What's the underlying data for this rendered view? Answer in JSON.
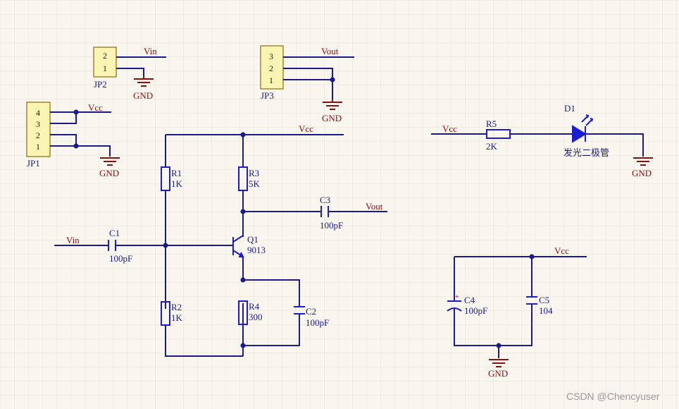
{
  "connectors": {
    "jp1": {
      "name": "JP1",
      "pins": [
        "4",
        "3",
        "2",
        "1"
      ]
    },
    "jp2": {
      "name": "JP2",
      "pins": [
        "2",
        "1"
      ]
    },
    "jp3": {
      "name": "JP3",
      "pins": [
        "3",
        "2",
        "1"
      ]
    }
  },
  "nets": {
    "vin": "Vin",
    "vout": "Vout",
    "vcc": "Vcc",
    "gnd": "GND"
  },
  "components": {
    "r1": {
      "name": "R1",
      "value": "1K"
    },
    "r2": {
      "name": "R2",
      "value": "1K"
    },
    "r3": {
      "name": "R3",
      "value": "5K"
    },
    "r4": {
      "name": "R4",
      "value": "300"
    },
    "r5": {
      "name": "R5",
      "value": "2K"
    },
    "c1": {
      "name": "C1",
      "value": "100pF"
    },
    "c2": {
      "name": "C2",
      "value": "100pF"
    },
    "c3": {
      "name": "C3",
      "value": "100pF"
    },
    "c4": {
      "name": "C4",
      "value": "100pF"
    },
    "c5": {
      "name": "C5",
      "value": "104"
    },
    "q1": {
      "name": "Q1",
      "value": "9013"
    },
    "d1": {
      "name": "D1",
      "value": "发光二极管"
    }
  },
  "c4_plus": "+",
  "watermark": "CSDN @Chencyuser",
  "colors": {
    "background": "#f8f6ee",
    "grid": "#e6e2d4",
    "wire": "#1a1a8c",
    "component": "#1c1cd0",
    "ground": "#8a1010",
    "header": "#fbf5b4"
  }
}
